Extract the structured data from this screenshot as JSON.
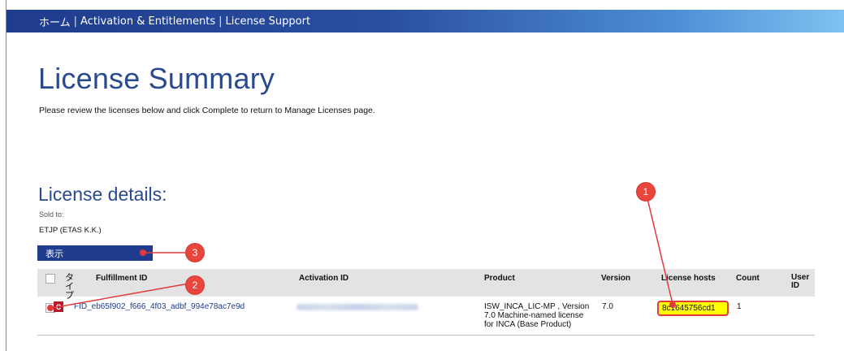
{
  "nav": {
    "home": "ホーム",
    "separator": "|",
    "activation": "Activation & Entitlements",
    "support": "License Support"
  },
  "page": {
    "title": "License Summary",
    "instructions": "Please review the licenses below and click Complete to return to Manage Licenses page."
  },
  "details": {
    "section_title": "License details:",
    "sold_to_label": "Sold to:",
    "sold_to_value": "ETJP (ETAS K.K.)",
    "view_select": "表示"
  },
  "table": {
    "headers": {
      "type": "タイプ",
      "fulfillment_id": "Fulfillment ID",
      "activation_id": "Activation ID",
      "product": "Product",
      "version": "Version",
      "license_hosts": "License hosts",
      "count": "Count",
      "user_id": "User ID"
    },
    "rows": [
      {
        "type_icon": "C",
        "fulfillment_id": "FID_eb65f902_f666_4f03_adbf_994e78ac7e9d",
        "product_line1": "ISW_INCA_LIC-MP , Version",
        "product_line2": "7.0 Machine-named license",
        "product_line3": "for INCA (Base Product)",
        "version": "7.0",
        "license_host": "8c1645756cd1",
        "count": "1"
      }
    ]
  },
  "callouts": [
    "1",
    "2",
    "3"
  ],
  "colors": {
    "brand_blue": "#1f3c8e",
    "title_blue": "#2a4a8f",
    "callout_red": "#e8453c",
    "highlight_yellow": "#ffff00"
  }
}
